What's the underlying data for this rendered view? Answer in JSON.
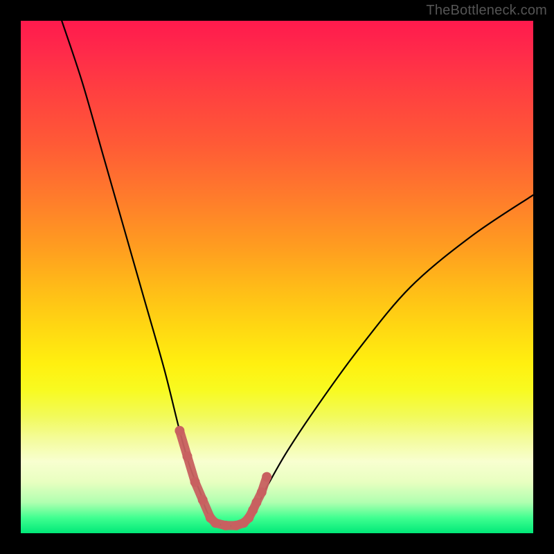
{
  "watermark": "TheBottleneck.com",
  "chart_data": {
    "type": "line",
    "title": "",
    "xlabel": "",
    "ylabel": "",
    "xlim": [
      0,
      100
    ],
    "ylim": [
      0,
      100
    ],
    "grid": false,
    "series": [
      {
        "name": "bottleneck-curve",
        "color": "#000000",
        "x": [
          8,
          12,
          16,
          20,
          24,
          28,
          31,
          33,
          35,
          36,
          37,
          38,
          40,
          42,
          44,
          45,
          46,
          48,
          52,
          58,
          66,
          76,
          88,
          100
        ],
        "y": [
          100,
          88,
          74,
          60,
          46,
          32,
          20,
          13,
          8,
          5,
          3,
          2,
          1.5,
          1.5,
          2,
          3,
          5,
          9,
          16,
          25,
          36,
          48,
          58,
          66
        ]
      },
      {
        "name": "highlight-band",
        "color": "#c86060",
        "x": [
          31,
          32.5,
          34,
          35.5,
          37,
          38,
          40,
          42,
          43.5,
          44.5,
          45.3,
          46,
          47,
          48
        ],
        "y": [
          20,
          15,
          10,
          6.5,
          3,
          2,
          1.5,
          1.5,
          2,
          3,
          4.5,
          6,
          8,
          11
        ]
      }
    ],
    "background_gradient": {
      "top": "#ff1a4d",
      "mid": "#fff010",
      "bottom": "#00e878"
    }
  }
}
